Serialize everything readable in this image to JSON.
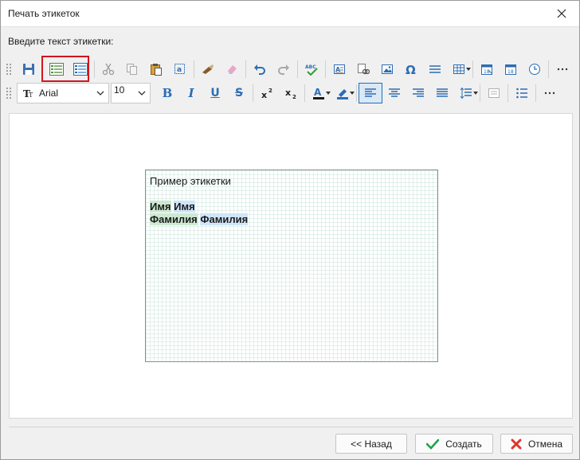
{
  "window": {
    "title": "Печать этикеток",
    "close_icon": "close-icon"
  },
  "prompt": "Введите текст этикетки:",
  "toolbar": {
    "font": "Arial",
    "size": "10",
    "bold": "B",
    "italic": "I",
    "underline": "U",
    "strike": "S"
  },
  "label": {
    "title": "Пример этикетки",
    "line1": [
      "Имя",
      "Имя"
    ],
    "line2": [
      "Фамилия",
      "Фамилия"
    ]
  },
  "footer": {
    "back": "<< Назад",
    "create": "Создать",
    "cancel": "Отмена"
  },
  "colors": {
    "highlight": "#d0161c",
    "accent": "#1f6fb5"
  }
}
